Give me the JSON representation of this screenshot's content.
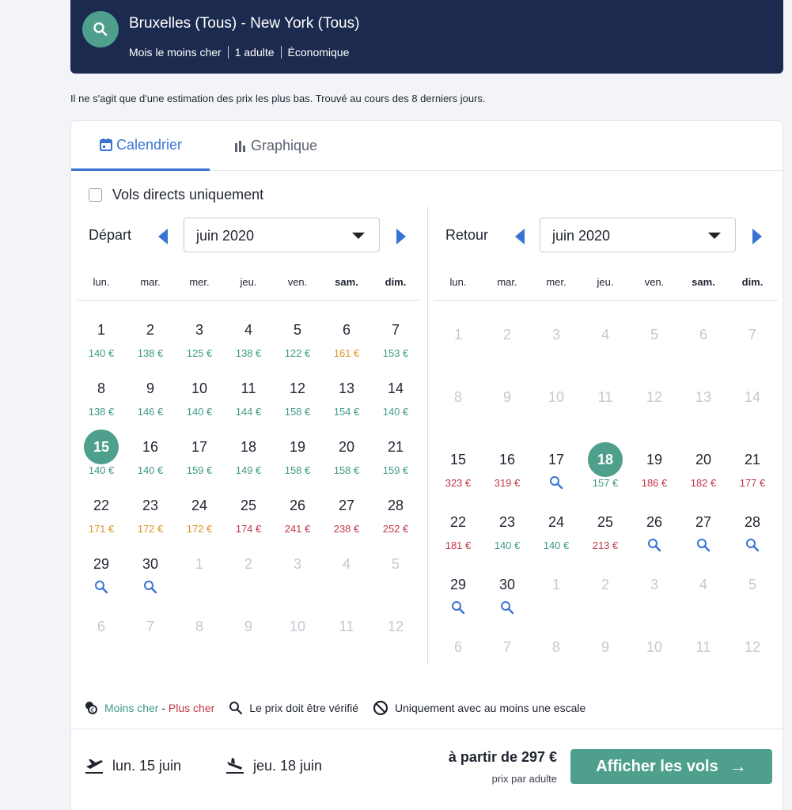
{
  "header": {
    "title": "Bruxelles (Tous) - New York (Tous)",
    "sub": [
      "Mois le moins cher",
      "1 adulte",
      "Économique"
    ]
  },
  "notice": "Il ne s'agit que d'une estimation des prix les plus bas. Trouvé au cours des 8 derniers jours.",
  "tabs": {
    "calendar": "Calendrier",
    "graph": "Graphique"
  },
  "direct_only": "Vols directs uniquement",
  "weekdays": [
    "lun.",
    "mar.",
    "mer.",
    "jeu.",
    "ven.",
    "sam.",
    "dim."
  ],
  "colors": {
    "accent": "#3873d4",
    "cheap": "#3f9a86",
    "mid": "#e0951f",
    "expensive": "#c2374a",
    "selected": "#4e9f8b",
    "header": "#1b2a4e"
  },
  "departure": {
    "label": "Départ",
    "month": "juin 2020",
    "rows": [
      [
        {
          "d": "1",
          "p": "140 €",
          "c": "green"
        },
        {
          "d": "2",
          "p": "138 €",
          "c": "green"
        },
        {
          "d": "3",
          "p": "125 €",
          "c": "green"
        },
        {
          "d": "4",
          "p": "138 €",
          "c": "green"
        },
        {
          "d": "5",
          "p": "122 €",
          "c": "green"
        },
        {
          "d": "6",
          "p": "161 €",
          "c": "orange"
        },
        {
          "d": "7",
          "p": "153 €",
          "c": "green"
        }
      ],
      [
        {
          "d": "8",
          "p": "138 €",
          "c": "green"
        },
        {
          "d": "9",
          "p": "146 €",
          "c": "green"
        },
        {
          "d": "10",
          "p": "140 €",
          "c": "green"
        },
        {
          "d": "11",
          "p": "144 €",
          "c": "green"
        },
        {
          "d": "12",
          "p": "158 €",
          "c": "green"
        },
        {
          "d": "13",
          "p": "154 €",
          "c": "green"
        },
        {
          "d": "14",
          "p": "140 €",
          "c": "green"
        }
      ],
      [
        {
          "d": "15",
          "p": "140 €",
          "c": "green",
          "sel": true
        },
        {
          "d": "16",
          "p": "140 €",
          "c": "green"
        },
        {
          "d": "17",
          "p": "159 €",
          "c": "green"
        },
        {
          "d": "18",
          "p": "149 €",
          "c": "green"
        },
        {
          "d": "19",
          "p": "158 €",
          "c": "green"
        },
        {
          "d": "20",
          "p": "158 €",
          "c": "green"
        },
        {
          "d": "21",
          "p": "159 €",
          "c": "green"
        }
      ],
      [
        {
          "d": "22",
          "p": "171 €",
          "c": "orange"
        },
        {
          "d": "23",
          "p": "172 €",
          "c": "orange"
        },
        {
          "d": "24",
          "p": "172 €",
          "c": "orange"
        },
        {
          "d": "25",
          "p": "174 €",
          "c": "red"
        },
        {
          "d": "26",
          "p": "241 €",
          "c": "red"
        },
        {
          "d": "27",
          "p": "238 €",
          "c": "red"
        },
        {
          "d": "28",
          "p": "252 €",
          "c": "red"
        }
      ],
      [
        {
          "d": "29",
          "s": true
        },
        {
          "d": "30",
          "s": true
        },
        {
          "d": "1",
          "dim": true
        },
        {
          "d": "2",
          "dim": true
        },
        {
          "d": "3",
          "dim": true
        },
        {
          "d": "4",
          "dim": true
        },
        {
          "d": "5",
          "dim": true
        }
      ],
      [
        {
          "d": "6",
          "dim": true
        },
        {
          "d": "7",
          "dim": true
        },
        {
          "d": "8",
          "dim": true
        },
        {
          "d": "9",
          "dim": true
        },
        {
          "d": "10",
          "dim": true
        },
        {
          "d": "11",
          "dim": true
        },
        {
          "d": "12",
          "dim": true
        }
      ]
    ]
  },
  "return": {
    "label": "Retour",
    "month": "juin 2020",
    "rows": [
      [
        {
          "d": "1",
          "dim": true
        },
        {
          "d": "2",
          "dim": true
        },
        {
          "d": "3",
          "dim": true
        },
        {
          "d": "4",
          "dim": true
        },
        {
          "d": "5",
          "dim": true
        },
        {
          "d": "6",
          "dim": true
        },
        {
          "d": "7",
          "dim": true
        }
      ],
      [
        {
          "d": "8",
          "dim": true
        },
        {
          "d": "9",
          "dim": true
        },
        {
          "d": "10",
          "dim": true
        },
        {
          "d": "11",
          "dim": true
        },
        {
          "d": "12",
          "dim": true
        },
        {
          "d": "13",
          "dim": true
        },
        {
          "d": "14",
          "dim": true
        }
      ],
      [
        {
          "d": "15",
          "p": "323 €",
          "c": "red"
        },
        {
          "d": "16",
          "p": "319 €",
          "c": "red"
        },
        {
          "d": "17",
          "s": true
        },
        {
          "d": "18",
          "p": "157 €",
          "c": "green",
          "sel": true
        },
        {
          "d": "19",
          "p": "186 €",
          "c": "red"
        },
        {
          "d": "20",
          "p": "182 €",
          "c": "red"
        },
        {
          "d": "21",
          "p": "177 €",
          "c": "red"
        }
      ],
      [
        {
          "d": "22",
          "p": "181 €",
          "c": "red"
        },
        {
          "d": "23",
          "p": "140 €",
          "c": "green"
        },
        {
          "d": "24",
          "p": "140 €",
          "c": "green"
        },
        {
          "d": "25",
          "p": "213 €",
          "c": "red"
        },
        {
          "d": "26",
          "s": true
        },
        {
          "d": "27",
          "s": true
        },
        {
          "d": "28",
          "s": true
        }
      ],
      [
        {
          "d": "29",
          "s": true
        },
        {
          "d": "30",
          "s": true
        },
        {
          "d": "1",
          "dim": true
        },
        {
          "d": "2",
          "dim": true
        },
        {
          "d": "3",
          "dim": true
        },
        {
          "d": "4",
          "dim": true
        },
        {
          "d": "5",
          "dim": true
        }
      ],
      [
        {
          "d": "6",
          "dim": true
        },
        {
          "d": "7",
          "dim": true
        },
        {
          "d": "8",
          "dim": true
        },
        {
          "d": "9",
          "dim": true
        },
        {
          "d": "10",
          "dim": true
        },
        {
          "d": "11",
          "dim": true
        },
        {
          "d": "12",
          "dim": true
        }
      ]
    ]
  },
  "legend": {
    "cheaper": "Moins cher",
    "dash": " - ",
    "pricier": "Plus cher",
    "verify": "Le prix doit être vérifié",
    "stopover": "Uniquement avec au moins une escale"
  },
  "footer": {
    "outbound": "lun. 15 juin",
    "inbound": "jeu. 18 juin",
    "from_price": "à partir de 297 €",
    "per_adult": "prix par adulte",
    "cta": "Afficher les vols",
    "cta_arrow": "→"
  }
}
